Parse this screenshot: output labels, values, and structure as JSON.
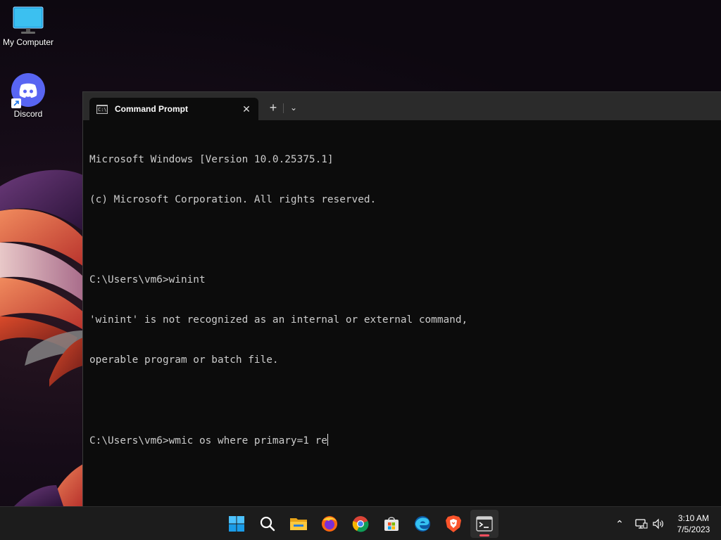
{
  "desktop": {
    "icons": [
      {
        "label": "My Computer"
      },
      {
        "label": "Discord"
      }
    ]
  },
  "terminal": {
    "tab_title": "Command Prompt",
    "tab_icon_text": "C:\\",
    "close_glyph": "✕",
    "new_tab_glyph": "+",
    "dropdown_glyph": "⌄",
    "lines": [
      "Microsoft Windows [Version 10.0.25375.1]",
      "(c) Microsoft Corporation. All rights reserved.",
      "",
      "C:\\Users\\vm6>winint",
      "'winint' is not recognized as an internal or external command,",
      "operable program or batch file.",
      "",
      "C:\\Users\\vm6>wmic os where primary=1 re"
    ]
  },
  "taskbar": {
    "apps": [
      {
        "name": "start-icon"
      },
      {
        "name": "search-icon"
      },
      {
        "name": "file-explorer-icon"
      },
      {
        "name": "firefox-icon"
      },
      {
        "name": "chrome-icon"
      },
      {
        "name": "microsoft-store-icon"
      },
      {
        "name": "edge-icon"
      },
      {
        "name": "brave-icon"
      },
      {
        "name": "terminal-icon",
        "active": true
      }
    ],
    "tray": {
      "chevron_glyph": "⌃"
    },
    "clock": {
      "time": "3:10 AM",
      "date": "7/5/2023"
    }
  },
  "colors": {
    "accent_indicator": "#ff4f5e",
    "terminal_bg": "#0c0c0c",
    "titlebar_bg": "#2b2b2b",
    "taskbar_bg": "#1c1c1c"
  }
}
